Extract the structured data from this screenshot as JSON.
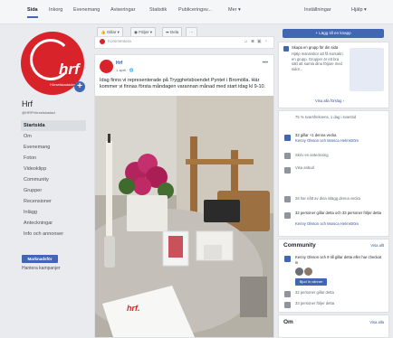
{
  "topnav": {
    "tabs": [
      "Sida",
      "Inkorg",
      "Evenemang",
      "Aviseringar",
      "Statistik",
      "Publiceringsv...",
      "Mer ▾"
    ],
    "right": [
      "Inställningar",
      "Hjälp ▾"
    ]
  },
  "page": {
    "logo_text": "hrf",
    "logo_subtext": "Hörselskadades",
    "name": "Hrf",
    "handle": "@HRFHörselskadad"
  },
  "sidebar": {
    "items": [
      "Startsida",
      "Om",
      "Evenemang",
      "Foton",
      "Videoklipp",
      "Community",
      "Grupper",
      "Recensioner",
      "Inlägg",
      "Anteckningar",
      "Info och annonser"
    ],
    "promote_label": "Marknadsför",
    "manage_label": "Hantera kampanjer"
  },
  "actions": {
    "like": "Gillar ▾",
    "follow": "Följer ▾",
    "share": "Dela",
    "more": "···"
  },
  "compose": {
    "placeholder": "Kommentera"
  },
  "post": {
    "author": "Hrf",
    "time": "1 april · 🌐",
    "text": "Idag finns vi representerade på Trygghetsboendet Pyntet i Bromölla. Här kommer vi finnas första måndagen varannan månad med start idag kl 9-10."
  },
  "right": {
    "like_button": "+ Lägg till en knapp",
    "group_title": "Skapa en grupp för din sida",
    "group_text": "Hjälp människor att få kontakt i en grupp. Grupper är ett bra sätt att samla dina följare med sidor...",
    "group_link": "Visa alla förslag ›",
    "stats": [
      "75 % svarsfrekvens, 1 dag i svarstid",
      "32 gillar +1 denna vecka",
      "Kenny Olsson och Monica Helmström",
      "Skriv en anteckning",
      "Visa anbud",
      "26 har nått av dina inlägg denna vecka",
      "32 personer gillar detta och 33 personer följer detta",
      "Kenny Olsson och Monica Helmström"
    ],
    "community_title": "Community",
    "community_link": "Visa allt",
    "community_invite": "Kenny Olsson och 9 till gillar detta eller har checkat in",
    "invite_button": "Bjud in vänner",
    "likes": "32 personer gillar detta",
    "follows": "33 personer följer detta",
    "about_title": "Om",
    "about_link": "Visa alla"
  },
  "colors": {
    "brand_red": "#d8232a",
    "fb_blue": "#4267b2"
  }
}
